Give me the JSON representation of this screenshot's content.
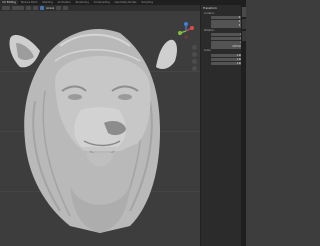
{
  "workspace_tabs": [
    "UV Editing",
    "Texture Paint",
    "Shading",
    "Animation",
    "Rendering",
    "Compositing",
    "Geometry Nodes",
    "Scripting"
  ],
  "active_tab_index": 0,
  "viewport_header": {
    "mode_label": "Global"
  },
  "properties_panel": {
    "transform_title": "Transform",
    "location_label": "Location:",
    "location_values": [
      "0 m",
      "0 m",
      "0 m"
    ],
    "rotation_label": "Rotation:",
    "rotation_values": [
      "0°",
      "0°",
      "0°"
    ],
    "rotation_mode": "XYZ Euler",
    "scale_label": "Scale:",
    "scale_values": [
      "1.000",
      "1.000",
      "1.000"
    ]
  },
  "colors": {
    "viewport_bg": "#3d3d3d",
    "panel_bg": "#2b2b2b",
    "header_bg": "#2f2f2f",
    "accent": "#4772b3",
    "gizmo_x": "#e04a4a",
    "gizmo_y": "#7fbf3f",
    "gizmo_z": "#3f7fd8",
    "model": "#c9c9c9"
  },
  "icons": {
    "gizmo": "axis-gizmo-icon",
    "zoom": "zoom-icon",
    "pan": "hand-icon",
    "camera": "camera-icon",
    "ortho": "grid-icon"
  }
}
